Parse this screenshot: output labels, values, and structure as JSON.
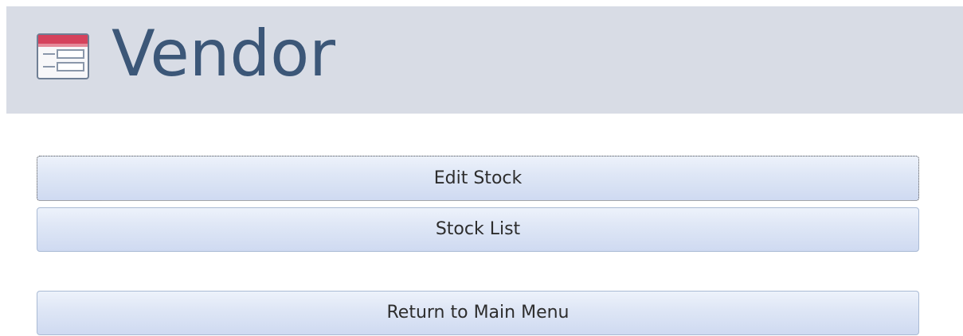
{
  "form": {
    "title": "Vendor",
    "icon": "form-icon"
  },
  "buttons": {
    "edit_stock": "Edit Stock",
    "stock_list": "Stock List",
    "return_main_menu": "Return to Main Menu"
  },
  "colors": {
    "header_background": "#d8dce5",
    "title_text": "#3c5778",
    "button_fill": "#dfe7f6",
    "button_border": "#a9bad4"
  }
}
